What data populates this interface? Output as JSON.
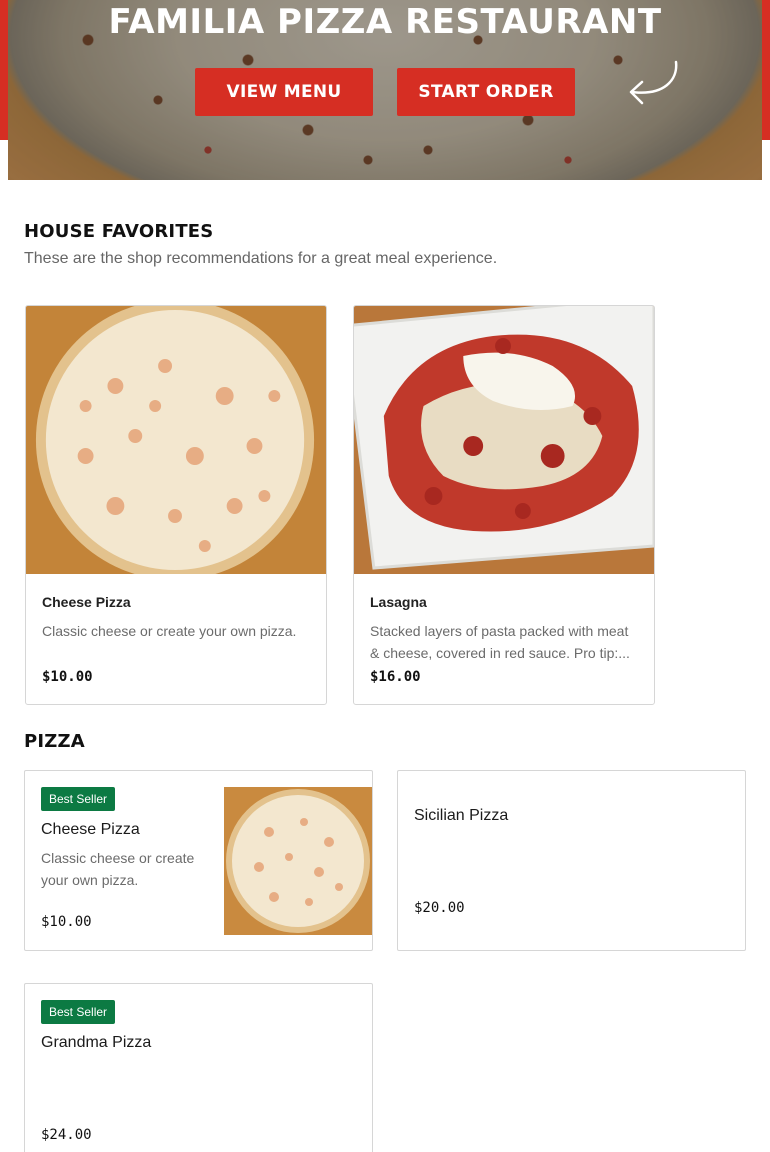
{
  "hero": {
    "title": "FAMILIA PIZZA RESTAURANT",
    "view_menu_label": "VIEW MENU",
    "start_order_label": "START ORDER"
  },
  "house_favorites": {
    "title": "HOUSE FAVORITES",
    "subtitle": "These are the shop recommendations for a great meal experience.",
    "items": [
      {
        "name": "Cheese Pizza",
        "description": "Classic cheese or create your own pizza.",
        "price": "$10.00"
      },
      {
        "name": "Lasagna",
        "description": "Stacked layers of pasta packed with meat & cheese, covered in red sauce. Pro tip:...",
        "price": "$16.00"
      }
    ]
  },
  "pizza": {
    "title": "PIZZA",
    "items": [
      {
        "badge": "Best Seller",
        "name": "Cheese Pizza",
        "description": "Classic cheese or create your own pizza.",
        "price": "$10.00"
      },
      {
        "name": "Sicilian Pizza",
        "price": "$20.00"
      },
      {
        "badge": "Best Seller",
        "name": "Grandma Pizza",
        "price": "$24.00"
      }
    ]
  },
  "colors": {
    "brand_red": "#d62e23",
    "badge_green": "#0c7a43"
  }
}
